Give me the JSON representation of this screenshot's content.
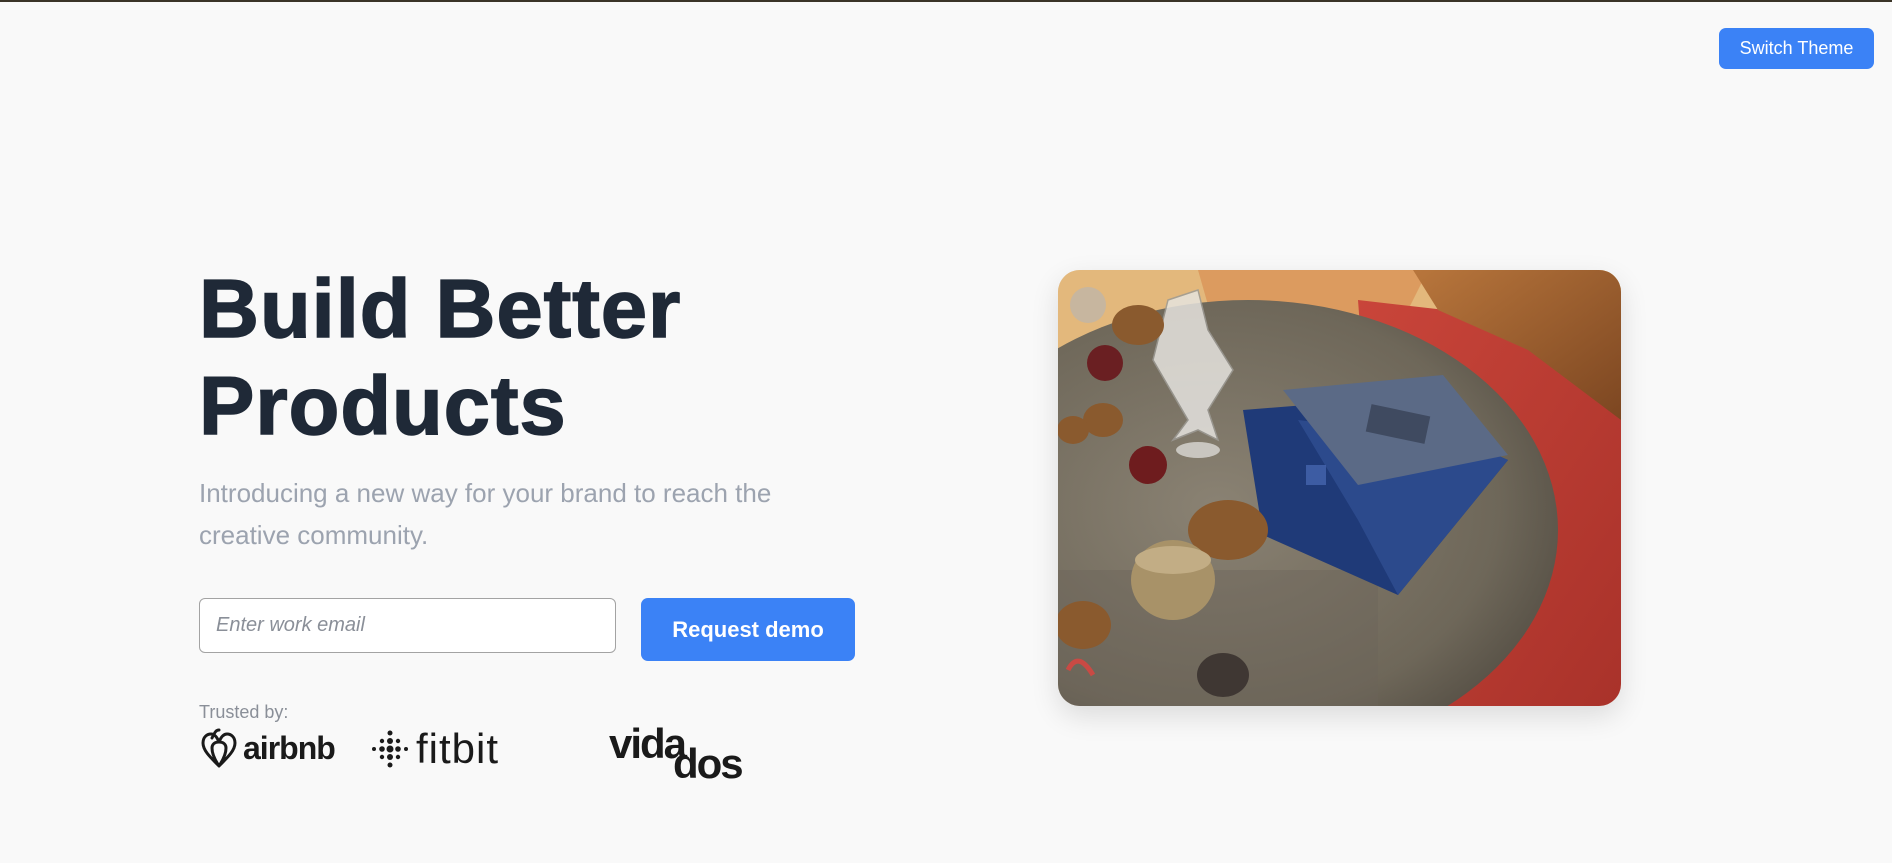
{
  "header": {
    "theme_button_label": "Switch Theme"
  },
  "hero": {
    "title_line1": "Build Better",
    "title_line2": "Products",
    "subtitle": "Introducing a new way for your brand to reach the creative community.",
    "email_placeholder": "Enter work email",
    "email_value": "",
    "cta_label": "Request demo"
  },
  "trusted": {
    "label": "Trusted by:",
    "logos": [
      {
        "name": "airbnb",
        "text": "airbnb",
        "icon": "airbnb-belo-icon"
      },
      {
        "name": "fitbit",
        "text": "fitbit",
        "icon": "fitbit-dots-icon"
      },
      {
        "name": "vidados",
        "text_top": "vida",
        "text_bottom": "dos"
      }
    ]
  },
  "image": {
    "subject": "laptop-on-table-photo"
  },
  "colors": {
    "accent": "#3b82f6",
    "title": "#1f2937",
    "muted": "#9ca3af",
    "background": "#f9f9f9"
  }
}
